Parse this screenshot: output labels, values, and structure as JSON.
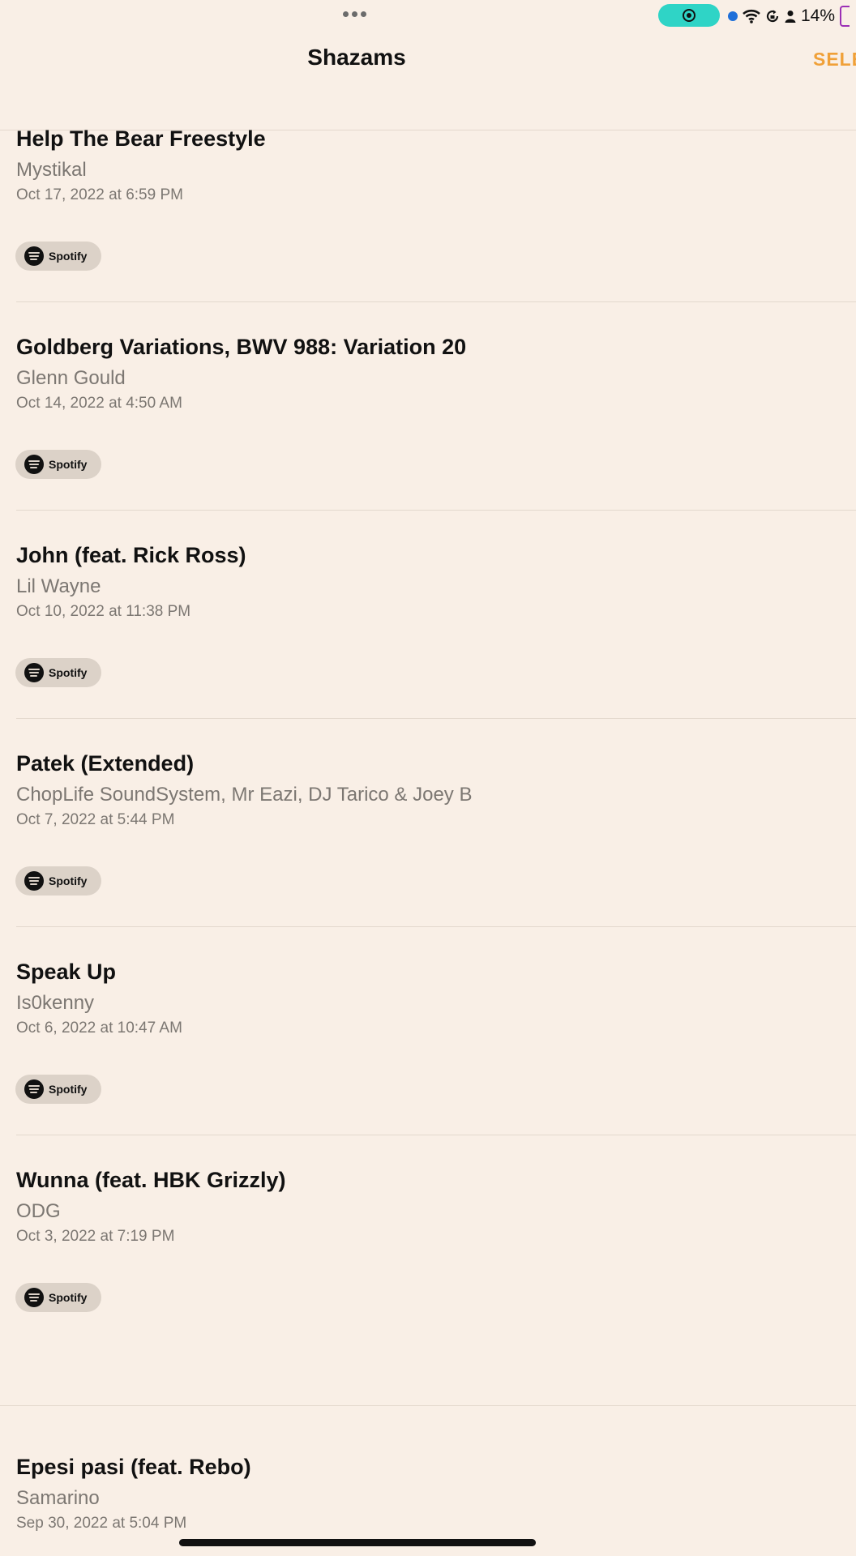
{
  "status_bar": {
    "battery_percent": "14%",
    "icons": [
      "more-dots-icon",
      "screen-record-icon",
      "location-dot-icon",
      "wifi-icon",
      "rotation-lock-icon",
      "person-icon",
      "battery-icon"
    ]
  },
  "nav": {
    "title": "Shazams",
    "select_label": "SELE"
  },
  "items": [
    {
      "title": "Help The Bear Freestyle",
      "artist": "Mystikal",
      "date": "Oct 17, 2022 at 6:59 PM",
      "service": "Spotify"
    },
    {
      "title": "Goldberg Variations, BWV 988: Variation 20",
      "artist": "Glenn Gould",
      "date": "Oct 14, 2022 at 4:50 AM",
      "service": "Spotify"
    },
    {
      "title": "John (feat. Rick Ross)",
      "artist": "Lil Wayne",
      "date": "Oct 10, 2022 at 11:38 PM",
      "service": "Spotify"
    },
    {
      "title": "Patek (Extended)",
      "artist": "ChopLife SoundSystem, Mr Eazi, DJ Tarico & Joey B",
      "date": "Oct 7, 2022 at 5:44 PM",
      "service": "Spotify"
    },
    {
      "title": "Speak Up",
      "artist": "Is0kenny",
      "date": "Oct 6, 2022 at 10:47 AM",
      "service": "Spotify"
    },
    {
      "title": "Wunna (feat. HBK Grizzly)",
      "artist": "ODG",
      "date": "Oct 3, 2022 at 7:19 PM",
      "service": "Spotify"
    },
    {
      "title": "Epesi pasi (feat. Rebo)",
      "artist": "Samarino",
      "date": "Sep 30, 2022 at 5:04 PM"
    }
  ],
  "colors": {
    "background": "#f9efe6",
    "accent": "#f0a038",
    "record_pill": "#2fd4c6"
  }
}
